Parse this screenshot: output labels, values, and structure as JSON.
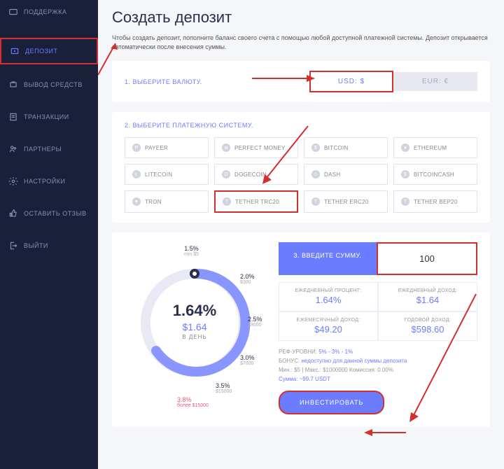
{
  "sidebar": {
    "items": [
      {
        "label": "ПОДДЕРЖКА",
        "icon": "support"
      },
      {
        "label": "ДЕПОЗИТ",
        "icon": "deposit",
        "active": true
      },
      {
        "label": "ВЫВОД СРЕДСТВ",
        "icon": "withdraw"
      },
      {
        "label": "ТРАНЗАКЦИИ",
        "icon": "transactions"
      },
      {
        "label": "ПАРТНЕРЫ",
        "icon": "partners"
      },
      {
        "label": "НАСТРОЙКИ",
        "icon": "settings"
      },
      {
        "label": "ОСТАВИТЬ ОТЗЫВ",
        "icon": "review"
      },
      {
        "label": "ВЫЙТИ",
        "icon": "logout"
      }
    ]
  },
  "page": {
    "title": "Создать депозит",
    "description": "Чтобы создать депозит, пополните баланс своего счета с помощью любой доступной платежной системы. Депозит открывается автоматически после внесения суммы."
  },
  "currency": {
    "label": "1. ВЫБЕРИТЕ ВАЛЮТУ.",
    "options": [
      {
        "label": "USD: $",
        "active": true
      },
      {
        "label": "EUR: €",
        "active": false
      }
    ]
  },
  "payment": {
    "label": "2. ВЫБЕРИТЕ ПЛАТЕЖНУЮ СИСТЕМУ.",
    "options": [
      {
        "label": "PAYEER",
        "glyph": "P"
      },
      {
        "label": "PERFECT MONEY",
        "glyph": "м"
      },
      {
        "label": "BITCOIN",
        "glyph": "$"
      },
      {
        "label": "ETHEREUM",
        "glyph": "♦"
      },
      {
        "label": "LITECOIN",
        "glyph": "Ł"
      },
      {
        "label": "DOGECOIN",
        "glyph": "D"
      },
      {
        "label": "DASH",
        "glyph": "⊃"
      },
      {
        "label": "BITCOINCASH",
        "glyph": "$"
      },
      {
        "label": "TRON",
        "glyph": "♥"
      },
      {
        "label": "TETHER TRC20",
        "glyph": "T",
        "selected": true
      },
      {
        "label": "TETHER ERC20",
        "glyph": "T"
      },
      {
        "label": "TETHER BEP20",
        "glyph": "T"
      }
    ]
  },
  "deposit": {
    "dial": {
      "percent": "1.64%",
      "amount": "$1.64",
      "period": "В ДЕНЬ",
      "ticks": [
        {
          "percent": "1.5%",
          "sub": "min $5"
        },
        {
          "percent": "2.0%",
          "sub": "$300"
        },
        {
          "percent": "2.5%",
          "sub": "$3000"
        },
        {
          "percent": "3.0%",
          "sub": "$7000"
        },
        {
          "percent": "3.5%",
          "sub": "$15000"
        },
        {
          "percent": "3.8%",
          "sub": "более $15000"
        }
      ]
    },
    "amount": {
      "label": "3. ВВЕДИТЕ СУММУ.",
      "value": "100"
    },
    "stats": [
      {
        "label": "ЕЖЕДНЕВНЫЙ ПРОЦЕНТ:",
        "value": "1.64%"
      },
      {
        "label": "ЕЖЕДНЕВНЫЙ ДОХОД:",
        "value": "$1.64"
      },
      {
        "label": "ЕЖЕМЕСЯЧНЫЙ ДОХОД:",
        "value": "$49.20"
      },
      {
        "label": "ГОДОВОЙ ДОХОД:",
        "value": "$598.60"
      }
    ],
    "details": {
      "ref_label": "РЕФ-УРОВНИ:",
      "ref_value": "5% - 3% - 1%",
      "bonus_label": "БОНУС:",
      "bonus_value": "недоступно для данной суммы депозита",
      "limits": "Мин.: $5 | Макс.: $1000000    Комиссия: 0.00%",
      "sum": "Сумма: ~99.7 USDT"
    },
    "invest_label": "ИНВЕСТИРОВАТЬ"
  }
}
